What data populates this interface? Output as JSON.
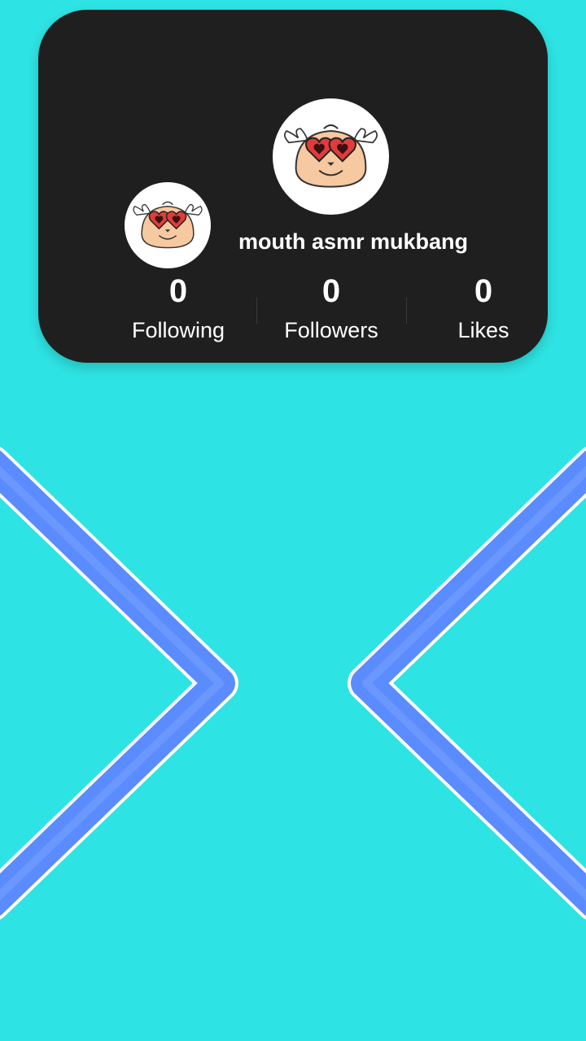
{
  "profile": {
    "username": "mouth asmr mukbang",
    "avatar_icon": "hamster-heart-glasses-icon",
    "stats": [
      {
        "value": "0",
        "label": "Following"
      },
      {
        "value": "0",
        "label": "Followers"
      },
      {
        "value": "0",
        "label": "Likes"
      }
    ]
  },
  "nav": {
    "prev_icon": "chevron-left-icon",
    "next_icon": "chevron-right-icon"
  },
  "colors": {
    "background": "#2ee3e3",
    "card": "#1f1f1f",
    "chevron_stroke": "#5b8cff",
    "chevron_outline": "#ffffff"
  }
}
